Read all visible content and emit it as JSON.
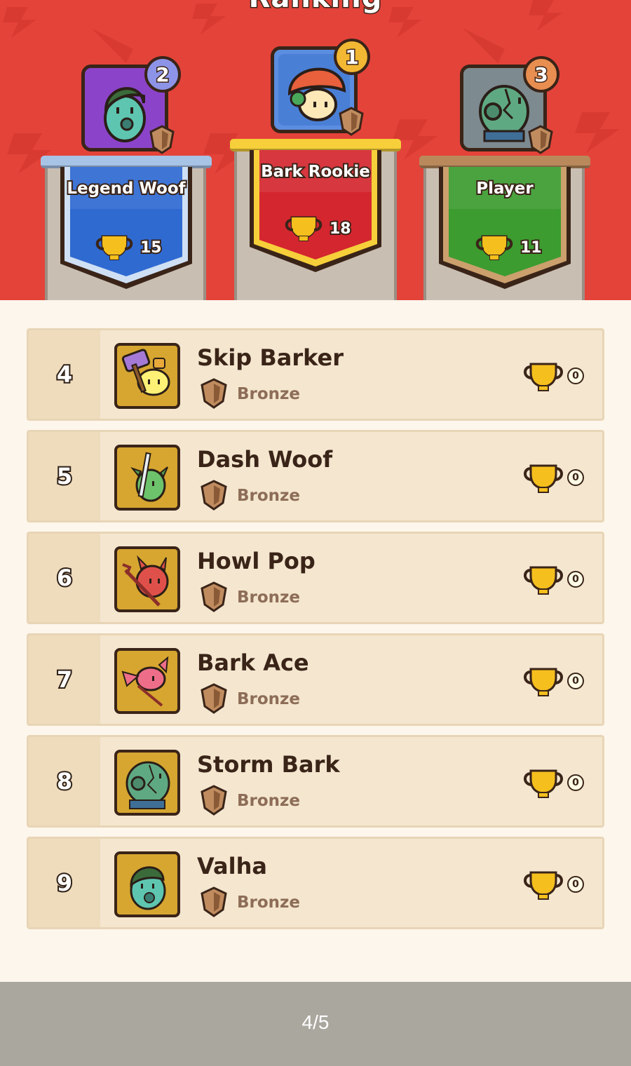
{
  "header": {
    "title": "Ranking"
  },
  "podium": [
    {
      "rank": "1",
      "name": "Bark Rookie",
      "trophies": "18",
      "banner_color": "#d4262f",
      "frame_color": "#f0b52a",
      "medal_color": "#f2b733",
      "avatar": "mushroom-avatar"
    },
    {
      "rank": "2",
      "name": "Legend Woof",
      "trophies": "15",
      "banner_color": "#2f6ad1",
      "frame_color": "#8b44c9",
      "medal_color": "#8d93e6",
      "avatar": "goblin-avatar"
    },
    {
      "rank": "3",
      "name": "Player",
      "trophies": "11",
      "banner_color": "#3c9c2f",
      "frame_color": "#8c9296",
      "medal_color": "#e88e50",
      "avatar": "zombie-avatar"
    }
  ],
  "list": [
    {
      "rank": "4",
      "name": "Skip Barker",
      "tier": "Bronze",
      "trophies": "0",
      "avatar": "chick-hammer-avatar"
    },
    {
      "rank": "5",
      "name": "Dash Woof",
      "tier": "Bronze",
      "trophies": "0",
      "avatar": "dragon-sword-avatar"
    },
    {
      "rank": "6",
      "name": "Howl Pop",
      "tier": "Bronze",
      "trophies": "0",
      "avatar": "devil-pitchfork-avatar"
    },
    {
      "rank": "7",
      "name": "Bark Ace",
      "tier": "Bronze",
      "trophies": "0",
      "avatar": "pink-demon-avatar"
    },
    {
      "rank": "8",
      "name": "Storm Bark",
      "tier": "Bronze",
      "trophies": "0",
      "avatar": "zombie-avatar"
    },
    {
      "rank": "9",
      "name": "Valha",
      "tier": "Bronze",
      "trophies": "0",
      "avatar": "goblin-avatar"
    }
  ],
  "footer": {
    "page_indicator": "4/5"
  },
  "colors": {
    "header_bg": "#e4433a",
    "list_bg": "#fdf6ec",
    "row_bg": "#f4e6cf",
    "trophy": "#f5bf1e",
    "footer_bg": "#aaa79f"
  }
}
